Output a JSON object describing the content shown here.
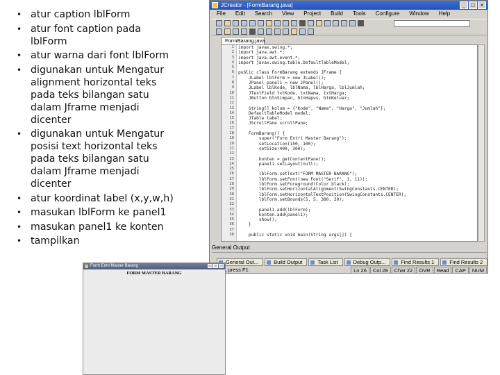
{
  "bullets": [
    "atur caption lblForm",
    "atur font caption pada lblForm",
    "atur warna dari font lblForm",
    "digunakan untuk Mengatur alignment horizontal teks pada teks bilangan satu dalam Jframe menjadi dicenter",
    "digunakan untuk Mengatur posisi text horizontal teks pada teks bilangan satu dalam Jframe menjadi dicenter",
    "atur koordinat label (x,y,w,h)",
    "masukan lblForm ke panel1",
    "masukan panel1 ke konten",
    "tampilkan"
  ],
  "ide": {
    "title": "JCreator - [FormBarang.java]",
    "menu": [
      "File",
      "Edit",
      "Search",
      "View",
      "Project",
      "Build",
      "Tools",
      "Configure",
      "Window",
      "Help"
    ],
    "file_tab": "FormBarang.java",
    "line_numbers": [
      "1",
      "2",
      "3",
      "4",
      "5",
      "6",
      "7",
      "8",
      "9",
      "10",
      "11",
      "12",
      "13",
      "14",
      "15",
      "16",
      "17",
      "18",
      "19",
      "20",
      "21",
      "22",
      "23",
      "24",
      "25",
      "26",
      "27",
      "28",
      "29",
      "30",
      "31",
      "32",
      "33",
      "34",
      "35",
      "36",
      "37",
      "38"
    ],
    "code": [
      "import javax.swing.*;",
      "import java.awt.*;",
      "import java.awt.event.*;",
      "import javax.swing.table.DefaultTableModel;",
      "",
      "public class FormBarang extends JFrame {",
      "    JLabel lblForm = new JLabel();",
      "    JPanel panel1 = new JPanel();",
      "    JLabel lblKode, lblNama, lblHarga, lblJumlah;",
      "    JTextField txtKode, txtNama, txtHarga;",
      "    JButton btnSimpan, btnHapus, btnKeluar;",
      "",
      "    String[] kolom = {\"Kode\", \"Nama\", \"Harga\", \"Jumlah\"};",
      "    DefaultTableModel model;",
      "    JTable tabel;",
      "    JScrollPane scrollPane;",
      "",
      "    FormBarang() {",
      "        super(\"Form Entri Master Barang\");",
      "        setLocation(150, 100);",
      "        setSize(400, 300);",
      "",
      "        konten = getContentPane();",
      "        panel1.setLayout(null);",
      "",
      "        lblForm.setText(\"FORM MASTER BARANG\");",
      "        lblForm.setFont(new Font(\"Serif\", 1, 11));",
      "        lblForm.setForeground(Color.black);",
      "        lblForm.setHorizontalAlignment(SwingConstants.CENTER);",
      "        lblForm.setHorizontalTextPosition(SwingConstants.CENTER);",
      "        lblForm.setBounds(5, 5, 380, 20);",
      "",
      "        panel1.add(lblForm);",
      "        konten.add(panel1);",
      "        show();",
      "    }",
      "",
      "    public static void main(String args[]) {"
    ],
    "output_title": "General Output",
    "bottom_tabs": [
      "General Out...",
      "Build Output",
      "Task List",
      "Debug Outp...",
      "Find Results 1",
      "Find Results 2"
    ],
    "status_message": "Help, press F1",
    "status_cells": [
      "Ln 26",
      "Col 28",
      "Char 22",
      "OVR",
      "Read",
      "CAP",
      "NUM"
    ]
  },
  "preview": {
    "title": "Form Entri Master Barang",
    "label": "FORM MASTER BARANG"
  }
}
